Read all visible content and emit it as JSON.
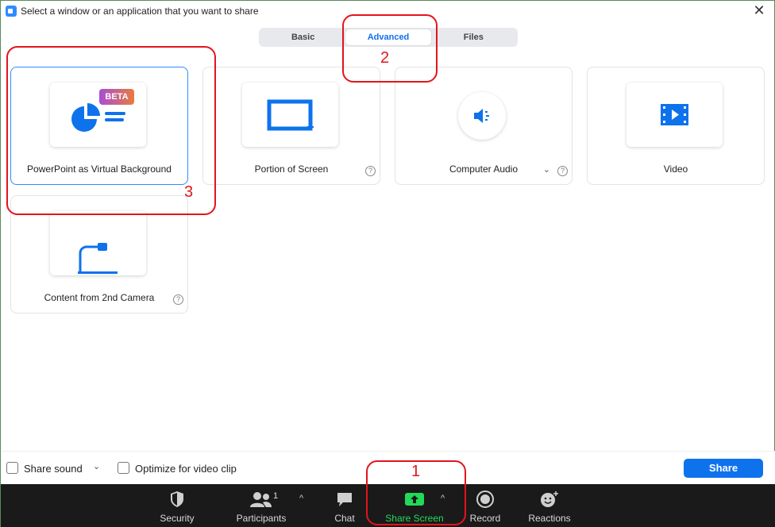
{
  "window": {
    "title": "Select a window or an application that you want to share",
    "close_glyph": "✕"
  },
  "tabs": [
    {
      "label": "Basic",
      "active": false
    },
    {
      "label": "Advanced",
      "active": true
    },
    {
      "label": "Files",
      "active": false
    }
  ],
  "cards": [
    {
      "label": "PowerPoint as Virtual Background",
      "badge": "BETA",
      "icon": "powerpoint-chart-icon",
      "selected": true
    },
    {
      "label": "Portion of Screen",
      "icon": "portion-of-screen-icon",
      "help": "?"
    },
    {
      "label": "Computer Audio",
      "icon": "speaker-icon",
      "help": "?",
      "chevron": "⌄"
    },
    {
      "label": "Video",
      "icon": "film-icon"
    },
    {
      "label": "Content from 2nd Camera",
      "icon": "document-camera-icon",
      "help": "?"
    }
  ],
  "options": {
    "share_sound_label": "Share sound",
    "share_sound_chevron": "⌄",
    "optimize_label": "Optimize for video clip",
    "share_button": "Share"
  },
  "toolbar": {
    "security": "Security",
    "participants": "Participants",
    "participants_count": "1",
    "chat": "Chat",
    "share_screen": "Share Screen",
    "record": "Record",
    "reactions": "Reactions",
    "caret": "^"
  },
  "annotations": [
    "1",
    "2",
    "3"
  ],
  "colors": {
    "accent": "#0e72ed",
    "annotation": "#e3141c",
    "share_green": "#23d959",
    "toolbar_bg": "#1a1a1a"
  }
}
